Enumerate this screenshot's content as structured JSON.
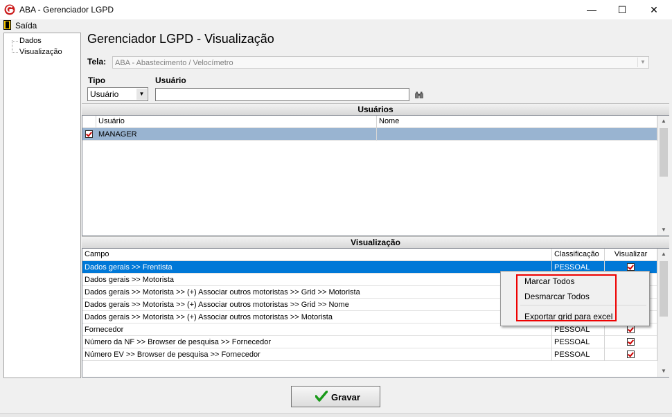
{
  "window": {
    "title": "ABA - Gerenciador LGPD",
    "minimize_glyph": "—",
    "maximize_glyph": "☐",
    "close_glyph": "✕"
  },
  "menu": {
    "exit_label": "Saída"
  },
  "tree": {
    "items": [
      "Dados",
      "Visualização"
    ]
  },
  "form": {
    "page_title": "Gerenciador LGPD - Visualização",
    "tela_label": "Tela:",
    "tela_value": "ABA - Abastecimento / Velocímetro",
    "tipo_label": "Tipo",
    "tipo_value": "Usuário",
    "usuario_label": "Usuário",
    "usuario_value": ""
  },
  "users_section": {
    "header": "Usuários",
    "columns": [
      "Usuário",
      "Nome"
    ],
    "rows": [
      {
        "usuario": "MANAGER",
        "nome": "",
        "checked": true
      }
    ]
  },
  "view_section": {
    "header": "Visualização",
    "columns": [
      "Campo",
      "Classificação",
      "Visualizar"
    ],
    "rows": [
      {
        "campo": "Dados gerais >> Frentista",
        "classificacao": "PESSOAL",
        "visualizar": true
      },
      {
        "campo": "Dados gerais >> Motorista",
        "classificacao": "",
        "visualizar": false
      },
      {
        "campo": "Dados gerais >> Motorista >> (+) Associar outros motoristas >> Grid >> Motorista",
        "classificacao": "",
        "visualizar": false
      },
      {
        "campo": "Dados gerais >> Motorista >> (+) Associar outros motoristas >> Grid >> Nome",
        "classificacao": "",
        "visualizar": false
      },
      {
        "campo": "Dados gerais >> Motorista >> (+) Associar outros motoristas >> Motorista",
        "classificacao": "",
        "visualizar": false
      },
      {
        "campo": "Fornecedor",
        "classificacao": "PESSOAL",
        "visualizar": true
      },
      {
        "campo": "Número da NF >> Browser de pesquisa >> Fornecedor",
        "classificacao": "PESSOAL",
        "visualizar": true
      },
      {
        "campo": "Número EV >> Browser de pesquisa >> Fornecedor",
        "classificacao": "PESSOAL",
        "visualizar": true
      }
    ]
  },
  "context_menu": {
    "items": [
      "Marcar Todos",
      "Desmarcar Todos",
      "Exportar grid para excel"
    ]
  },
  "buttons": {
    "gravar": "Gravar"
  },
  "colors": {
    "selection_blue": "#0078d7",
    "row_highlight": "#99b4d1",
    "highlight_box": "#e00000",
    "app_icon_red": "#cc1f1f",
    "gravar_check_green": "#1a9a1a"
  },
  "icons": [
    "app-logo-icon",
    "exit-door-icon",
    "binoculars-icon",
    "checkmark-icon"
  ]
}
